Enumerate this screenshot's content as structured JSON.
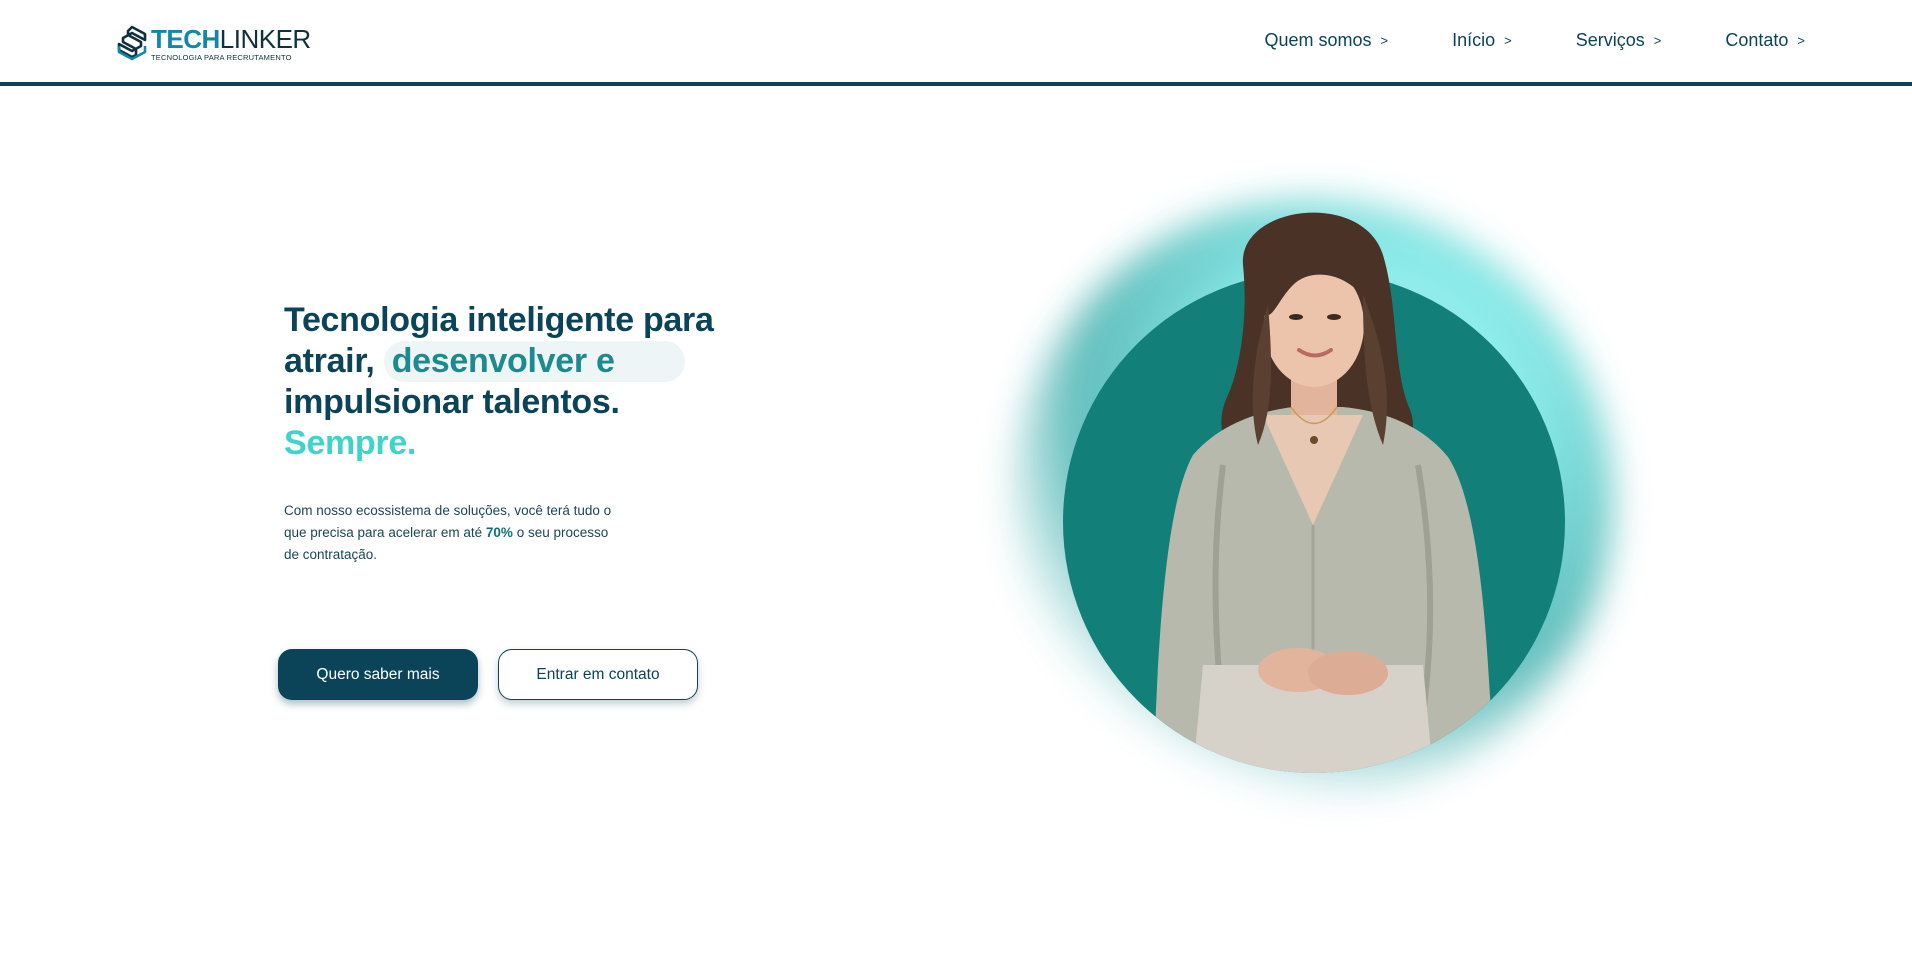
{
  "brand": {
    "name_part1": "TECH",
    "name_part2": "LINKER",
    "tagline": "TECNOLOGIA PARA RECRUTAMENTO",
    "colors": {
      "primary": "#0b4459",
      "accent": "#3fd4c9",
      "teal": "#137f79",
      "logo_blue": "#1388a6"
    }
  },
  "nav": {
    "items": [
      {
        "label": "Quem somos",
        "chevron": ">"
      },
      {
        "label": "Início",
        "chevron": ">"
      },
      {
        "label": "Serviços",
        "chevron": ">"
      },
      {
        "label": "Contato",
        "chevron": ">"
      }
    ]
  },
  "hero": {
    "headline_1": "Tecnologia inteligente para atrair,",
    "headline_highlight": "desenvolver e",
    "headline_2": "impulsionar talentos.",
    "headline_accent": "Sempre.",
    "sub_1": "Com nosso ecossistema de soluções, você terá tudo o que precisa para acelerar em até",
    "sub_bold": "70%",
    "sub_2": "o seu processo de contratação.",
    "primary_button": "Quero saber mais",
    "secondary_button": "Entrar em contato"
  }
}
